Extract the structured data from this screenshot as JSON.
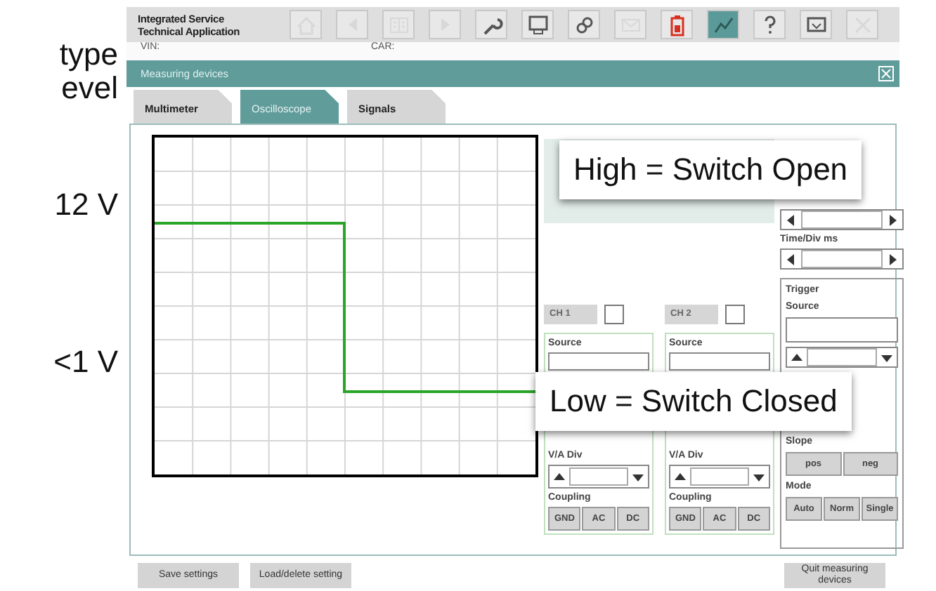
{
  "side_text": {
    "lines": [
      "type",
      "evel"
    ],
    "voltages": [
      "12 V",
      "<1 V"
    ]
  },
  "app": {
    "title_lines": [
      "Integrated Service",
      "Technical Application"
    ],
    "toolbar": [
      {
        "kind": "home",
        "disabled": true,
        "selected": false
      },
      {
        "kind": "back",
        "disabled": true,
        "selected": false
      },
      {
        "kind": "book",
        "disabled": true,
        "selected": false
      },
      {
        "kind": "forward",
        "disabled": true,
        "selected": false
      },
      {
        "kind": "wrench",
        "disabled": false,
        "selected": false
      },
      {
        "kind": "tester",
        "disabled": false,
        "selected": false
      },
      {
        "kind": "link",
        "disabled": false,
        "selected": false
      },
      {
        "kind": "mail",
        "disabled": true,
        "selected": false
      },
      {
        "kind": "battery",
        "disabled": false,
        "selected": false
      },
      {
        "kind": "scope",
        "disabled": false,
        "selected": true
      },
      {
        "kind": "help",
        "disabled": false,
        "selected": false
      },
      {
        "kind": "display",
        "disabled": false,
        "selected": false
      },
      {
        "kind": "close",
        "disabled": true,
        "selected": false
      }
    ],
    "vin_label": "VIN:",
    "car_label": "CAR:",
    "panel_title": "Measuring devices",
    "tabs": [
      {
        "label": "Multimeter",
        "selected": false
      },
      {
        "label": "Oscilloscope",
        "selected": true
      },
      {
        "label": "Signals",
        "selected": false
      }
    ],
    "time_div_label": "Time/Div ms",
    "channels": [
      {
        "name": "CH 1",
        "checked": false,
        "source_label": "Source",
        "div_label": "V/A Div",
        "coupling_label": "Coupling",
        "coupling": [
          "GND",
          "AC",
          "DC"
        ]
      },
      {
        "name": "CH 2",
        "checked": false,
        "source_label": "Source",
        "div_label": "V/A Div",
        "coupling_label": "Coupling",
        "coupling": [
          "GND",
          "AC",
          "DC"
        ]
      }
    ],
    "trigger": {
      "title": "Trigger",
      "source_label": "Source",
      "slope_label": "Slope",
      "slope": [
        "pos",
        "neg"
      ],
      "mode_label": "Mode",
      "mode": [
        "Auto",
        "Norm",
        "Single"
      ]
    },
    "buttons": [
      {
        "label": "Save settings"
      },
      {
        "label": "Load/delete setting"
      },
      {
        "label": "Quit measuring devices"
      }
    ]
  },
  "callouts": [
    "High = Switch Open",
    "Low = Switch Closed"
  ]
}
